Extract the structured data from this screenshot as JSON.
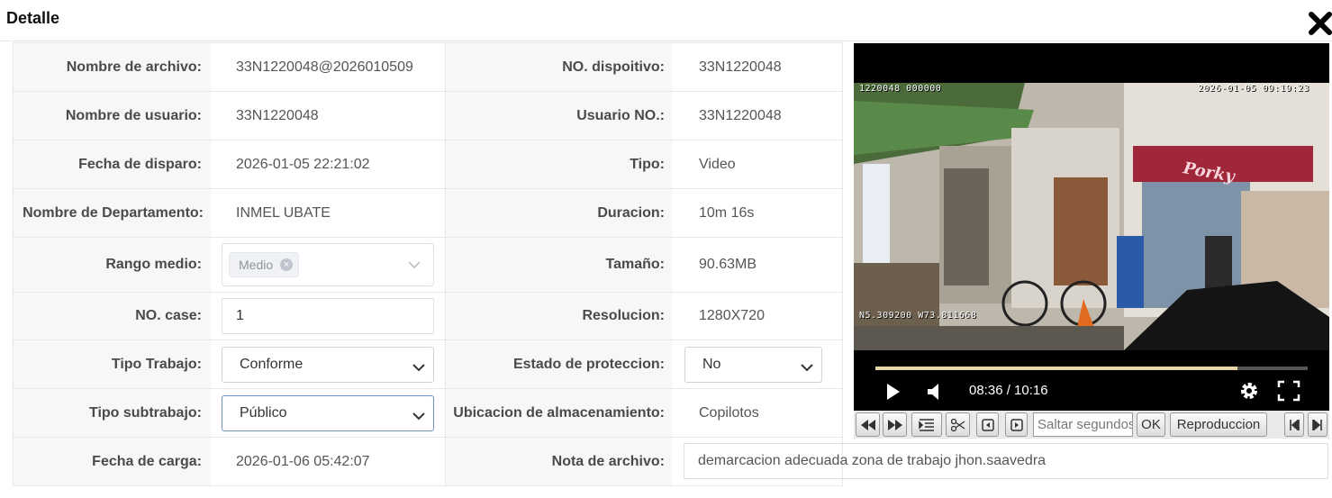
{
  "window": {
    "title": "Detalle"
  },
  "rows": [
    {
      "label1": "Nombre de archivo:",
      "value1": "33N1220048@2026010509",
      "label2": "NO. dispoitivo:",
      "value2": "33N1220048"
    },
    {
      "label1": "Nombre de usuario:",
      "value1": "33N1220048",
      "label2": "Usuario NO.:",
      "value2": "33N1220048"
    },
    {
      "label1": "Fecha de disparo:",
      "value1": "2026-01-05 22:21:02",
      "label2": "Tipo:",
      "value2": "Video"
    },
    {
      "label1": "Nombre de Departamento:",
      "value1": "INMEL UBATE",
      "label2": "Duracion:",
      "value2": "10m 16s"
    },
    {
      "label1": "Rango medio:",
      "label2": "Tamaño:",
      "value2": "90.63MB"
    },
    {
      "label1": "NO. case:",
      "label2": "Resolucion:",
      "value2": "1280X720"
    },
    {
      "label1": "Tipo Trabajo:",
      "label2": "Estado de proteccion:"
    },
    {
      "label1": "Tipo subtrabajo:",
      "label2": "Ubicacion de almacenamiento:",
      "value2": "Copilotos"
    },
    {
      "label1": "Fecha de carga:",
      "value1": "2026-01-06 05:42:07",
      "label2": "Nota de archivo:"
    }
  ],
  "form": {
    "rango_medio_tag": "Medio",
    "no_case_value": "1",
    "tipo_trabajo_selected": "Conforme",
    "estado_proteccion_selected": "No",
    "tipo_subtrabajo_selected": "Público",
    "nota_archivo_value": "demarcacion adecuada zona de trabajo jhon.saavedra"
  },
  "video": {
    "osd_top_left": "1220048 000000",
    "osd_top_right": "2026-01-05 09:19:23",
    "osd_bottom_left": "N5.309200 W73.811668",
    "sign_text": "Porky",
    "time_display": "08:36 / 10:16",
    "progress_fraction": 0.838
  },
  "toolbar": {
    "jump_placeholder": "Saltar segundos",
    "ok_label": "OK",
    "playback_label": "Reproduccion"
  },
  "icons": [
    "close-icon",
    "chevron-down-icon",
    "tag-close-icon",
    "play-icon",
    "volume-icon",
    "settings-gear-icon",
    "fullscreen-icon",
    "rewind-icon",
    "fast-forward-icon",
    "list-icon",
    "scissors-icon",
    "prev-frame-icon",
    "next-frame-icon",
    "skip-start-icon",
    "skip-end-icon"
  ]
}
